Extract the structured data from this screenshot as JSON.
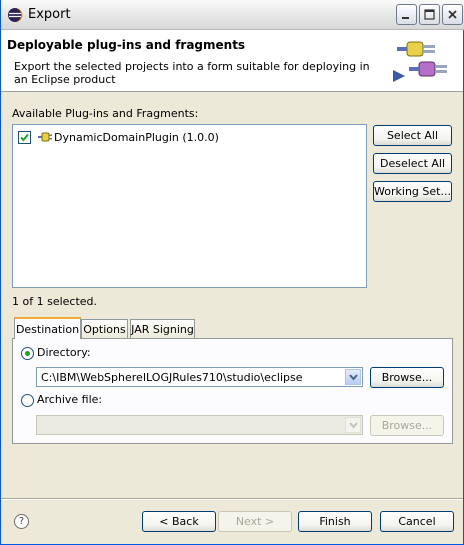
{
  "window": {
    "title": "Export"
  },
  "banner": {
    "title": "Deployable plug-ins and fragments",
    "description": "Export the selected projects into a form suitable for deploying in an Eclipse product"
  },
  "plugins": {
    "label": "Available Plug-ins and Fragments:",
    "items": [
      {
        "label": "DynamicDomainPlugin (1.0.0)",
        "checked": true
      }
    ],
    "selection_status": "1 of 1 selected."
  },
  "side_buttons": {
    "select_all": "Select All",
    "deselect_all": "Deselect All",
    "working_set": "Working Set..."
  },
  "tabs": [
    {
      "label": "Destination",
      "active": true
    },
    {
      "label": "Options",
      "active": false
    },
    {
      "label": "JAR Signing",
      "active": false
    }
  ],
  "destination": {
    "directory_label": "Directory:",
    "directory_value": "C:\\IBM\\WebSphereILOGJRules710\\studio\\eclipse",
    "archive_label": "Archive file:",
    "archive_value": "",
    "browse_label": "Browse...",
    "browse_archive_label": "Browse..."
  },
  "footer": {
    "help": "?",
    "back": "< Back",
    "next": "Next >",
    "finish": "Finish",
    "cancel": "Cancel"
  },
  "colors": {
    "accent_tab": "#f5a733",
    "selection_radio": "#21a121",
    "border_blue": "#7f9db9"
  }
}
